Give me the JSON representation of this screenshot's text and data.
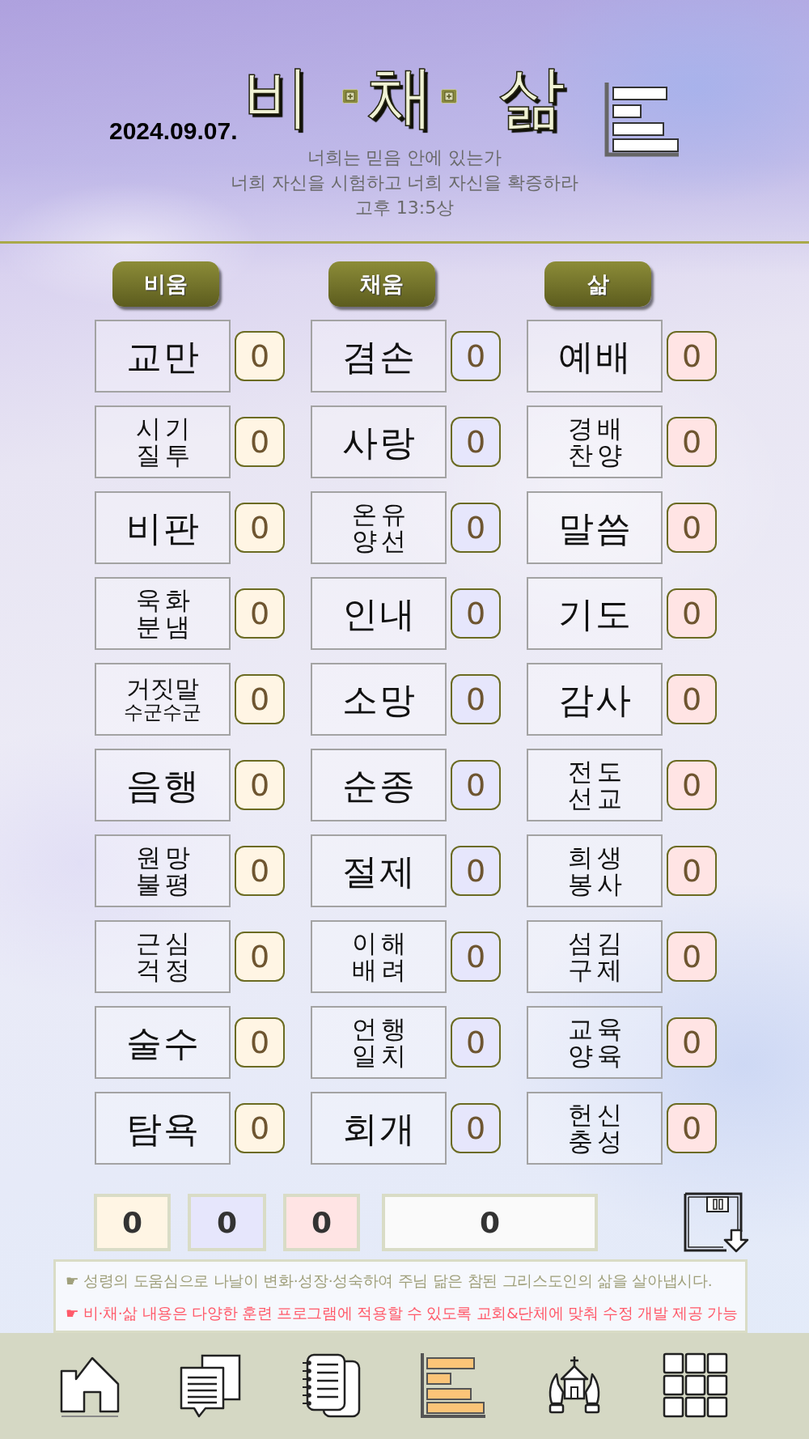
{
  "date": "2024.09.07.",
  "title_letters": [
    "비",
    "채",
    "삶"
  ],
  "verse": {
    "lines": [
      "너희는 믿음 안에 있는가",
      "너희 자신을 시험하고 너희 자신을 확증하라"
    ],
    "reference": "고후 13:5상"
  },
  "columns": [
    {
      "header": "비움",
      "color": "#fff5e4",
      "items": [
        {
          "lines": [
            "교만"
          ],
          "count": "0"
        },
        {
          "lines": [
            "시기",
            "질투"
          ],
          "count": "0"
        },
        {
          "lines": [
            "비판"
          ],
          "count": "0"
        },
        {
          "lines": [
            "욱화",
            "분냄"
          ],
          "count": "0"
        },
        {
          "lines": [
            "거짓말",
            "수군수군"
          ],
          "count": "0"
        },
        {
          "lines": [
            "음행"
          ],
          "count": "0"
        },
        {
          "lines": [
            "원망",
            "불평"
          ],
          "count": "0"
        },
        {
          "lines": [
            "근심",
            "걱정"
          ],
          "count": "0"
        },
        {
          "lines": [
            "술수"
          ],
          "count": "0"
        },
        {
          "lines": [
            "탐욕"
          ],
          "count": "0"
        }
      ]
    },
    {
      "header": "채움",
      "color": "#e6e6fc",
      "items": [
        {
          "lines": [
            "겸손"
          ],
          "count": "0"
        },
        {
          "lines": [
            "사랑"
          ],
          "count": "0"
        },
        {
          "lines": [
            "온유",
            "양선"
          ],
          "count": "0"
        },
        {
          "lines": [
            "인내"
          ],
          "count": "0"
        },
        {
          "lines": [
            "소망"
          ],
          "count": "0"
        },
        {
          "lines": [
            "순종"
          ],
          "count": "0"
        },
        {
          "lines": [
            "절제"
          ],
          "count": "0"
        },
        {
          "lines": [
            "이해",
            "배려"
          ],
          "count": "0"
        },
        {
          "lines": [
            "언행",
            "일치"
          ],
          "count": "0"
        },
        {
          "lines": [
            "회개"
          ],
          "count": "0"
        }
      ]
    },
    {
      "header": "삶",
      "color": "#ffe4e4",
      "items": [
        {
          "lines": [
            "예배"
          ],
          "count": "0"
        },
        {
          "lines": [
            "경배",
            "찬양"
          ],
          "count": "0"
        },
        {
          "lines": [
            "말씀"
          ],
          "count": "0"
        },
        {
          "lines": [
            "기도"
          ],
          "count": "0"
        },
        {
          "lines": [
            "감사"
          ],
          "count": "0"
        },
        {
          "lines": [
            "전도",
            "선교"
          ],
          "count": "0"
        },
        {
          "lines": [
            "희생",
            "봉사"
          ],
          "count": "0"
        },
        {
          "lines": [
            "섬김",
            "구제"
          ],
          "count": "0"
        },
        {
          "lines": [
            "교육",
            "양육"
          ],
          "count": "0"
        },
        {
          "lines": [
            "헌신",
            "충성"
          ],
          "count": "0"
        }
      ]
    }
  ],
  "totals": [
    {
      "value": "0",
      "color": "#fff5e4"
    },
    {
      "value": "0",
      "color": "#e6e6fc"
    },
    {
      "value": "0",
      "color": "#ffe4e4"
    },
    {
      "value": "0",
      "color": "#fafafa"
    }
  ],
  "notes": [
    {
      "text": "☛ 성령의 도움심으로 나날이 변화·성장·성숙하여 주님 닮은 참된 그리스도인의 삶을 살아냅시다.",
      "color": "#a0a07c"
    },
    {
      "text": "☛ 비·채·삶 내용은 다양한 훈련 프로그램에 적용할 수 있도록 교회&단체에 맞춰 수정 개발 제공 가능",
      "color": "#ff5a6a"
    }
  ],
  "nav": [
    {
      "kind": "home",
      "selected": false
    },
    {
      "kind": "documents",
      "selected": false
    },
    {
      "kind": "notebook",
      "selected": false
    },
    {
      "kind": "chart",
      "selected": true
    },
    {
      "kind": "church",
      "selected": false
    },
    {
      "kind": "grid",
      "selected": false
    }
  ]
}
